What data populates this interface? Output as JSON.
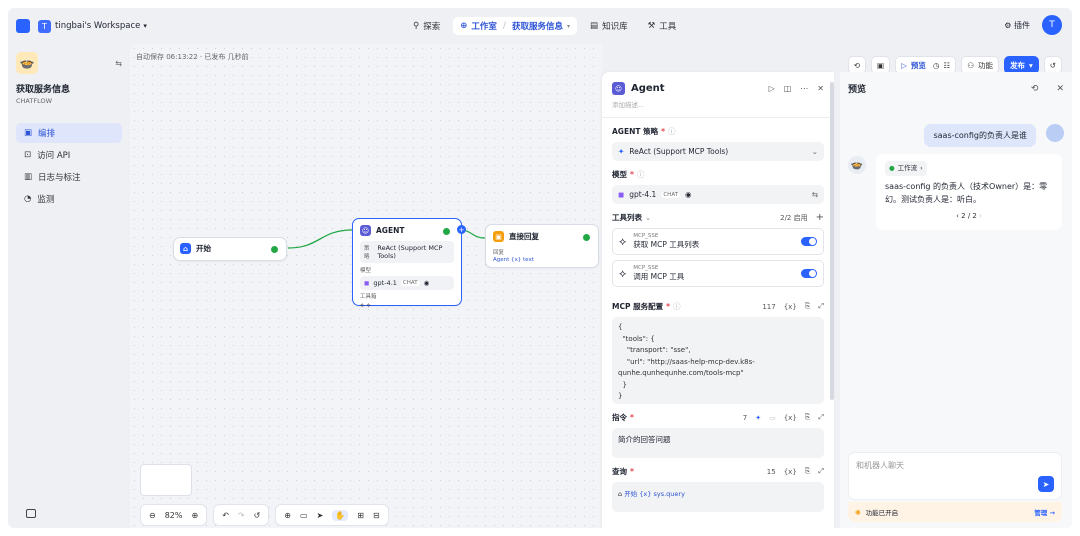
{
  "topbar": {
    "workspace_initial": "T",
    "workspace_name": "tingbai's Workspace",
    "nav": [
      {
        "icon": "⚲",
        "label": "探索"
      },
      {
        "icon": "⊕",
        "label": "工作室",
        "sub": "获取服务信息"
      },
      {
        "icon": "▤",
        "label": "知识库"
      },
      {
        "icon": "⚒",
        "label": "工具"
      }
    ],
    "plugins_label": "插件",
    "user_initial": "T"
  },
  "sidebar": {
    "app_name": "获取服务信息",
    "app_type": "CHATFLOW",
    "items": [
      {
        "icon": "▣",
        "label": "编排"
      },
      {
        "icon": "⊡",
        "label": "访问 API"
      },
      {
        "icon": "▥",
        "label": "日志与标注"
      },
      {
        "icon": "◔",
        "label": "监测"
      }
    ]
  },
  "toolbar": {
    "preview_label": "预览",
    "features_label": "功能",
    "publish_label": "发布"
  },
  "canvas": {
    "autosave": "自动保存 06:13:22 · 已发布 几秒前",
    "start_node": "开始",
    "agent_node": {
      "title": "AGENT",
      "strategy_label": "策略",
      "strategy_value": "ReAct (Support MCP Tools)",
      "model_label": "模型",
      "model_value": "gpt-4.1",
      "model_tag": "CHAT",
      "tools_label": "工具箱"
    },
    "answer_node": {
      "title": "直接回复",
      "reply_label": "回复",
      "reply_value": "Agent  {x} text"
    },
    "zoom": "82%"
  },
  "agent_panel": {
    "title": "Agent",
    "desc_placeholder": "添加描述...",
    "strategy_label": "AGENT 策略",
    "strategy_value": "ReAct (Support MCP Tools)",
    "model_label": "模型",
    "model_value": "gpt-4.1",
    "model_tag": "CHAT",
    "tools_label": "工具列表",
    "tools_count": "2/2 启用",
    "tools": [
      {
        "provider": "MCP_SSE",
        "name": "获取 MCP 工具列表"
      },
      {
        "provider": "MCP_SSE",
        "name": "调用 MCP 工具"
      }
    ],
    "mcp_label": "MCP 服务配置",
    "mcp_count": "117",
    "mcp_code": "{\n  \"tools\": {\n    \"transport\": \"sse\",\n    \"url\": \"http://saas-help-mcp-dev.k8s-\nqunhe.qunhequnhe.com/tools-mcp\"\n  }\n}",
    "instruction_label": "指令",
    "instruction_count": "7",
    "instruction_value": "简介的回答问题",
    "query_label": "查询",
    "query_count": "15",
    "query_value": "开始  {x} sys.query"
  },
  "preview": {
    "title": "预览",
    "user_message": "saas-config的负责人是谁",
    "workflow_chip": "工作流",
    "bot_message": "saas-config 的负责人（技术Owner）是：零幻。测试负责人是：听白。",
    "pager": "2 / 2",
    "input_placeholder": "和机器人聊天",
    "feature_text": "功能已开启",
    "manage_label": "管理 →"
  }
}
